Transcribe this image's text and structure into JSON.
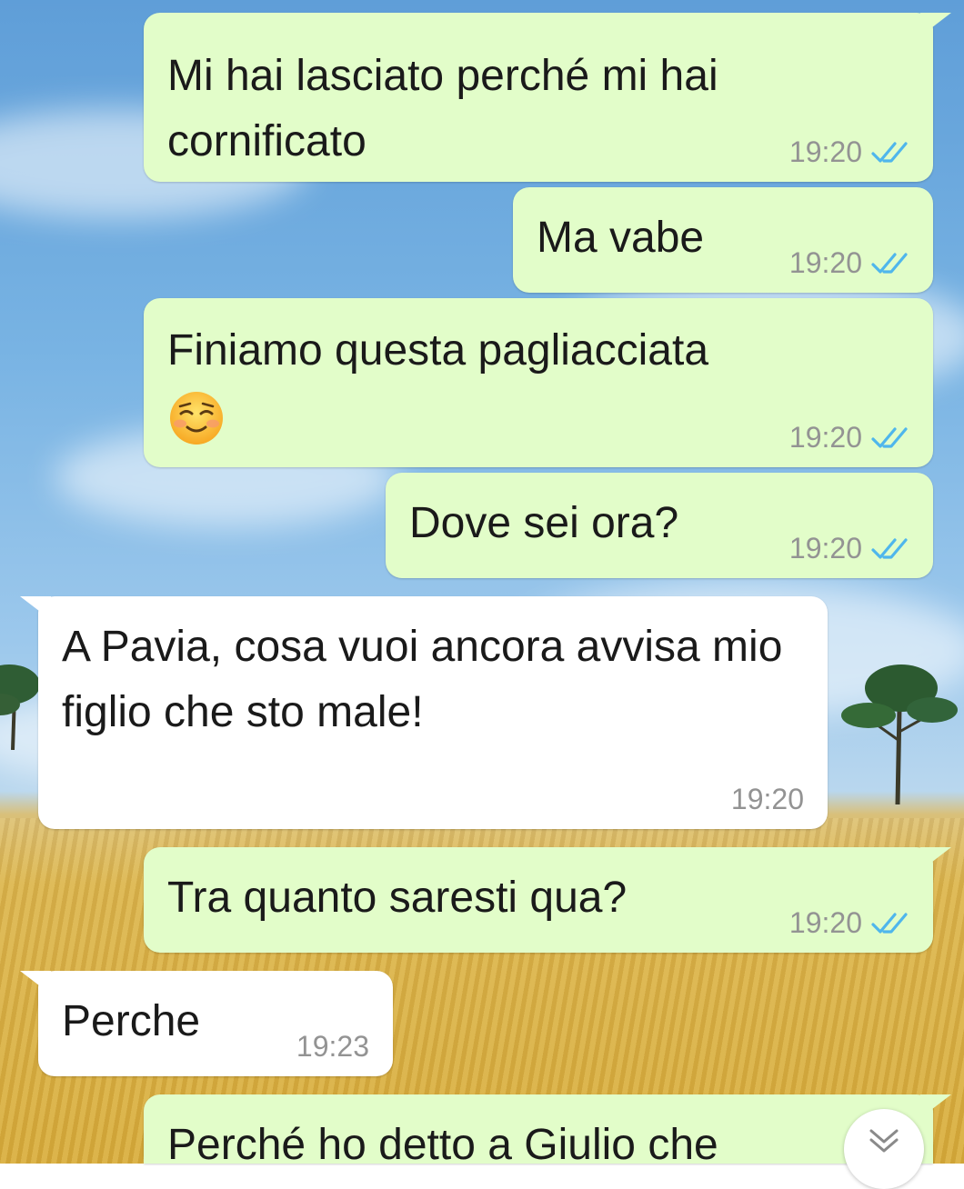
{
  "chat": {
    "messages": [
      {
        "direction": "outgoing",
        "text": "Mi hai lasciato perché mi hai cornificato",
        "time": "19:20",
        "status": "read"
      },
      {
        "direction": "outgoing",
        "text": "Ma vabe",
        "time": "19:20",
        "status": "read"
      },
      {
        "direction": "outgoing",
        "text": "Finiamo questa pagliacciata",
        "emoji": "smiling-face-emoji",
        "time": "19:20",
        "status": "read"
      },
      {
        "direction": "outgoing",
        "text": "Dove sei ora?",
        "time": "19:20",
        "status": "read"
      },
      {
        "direction": "incoming",
        "text": "A Pavia, cosa vuoi ancora avvisa mio figlio che sto male!",
        "time": "19:20"
      },
      {
        "direction": "outgoing",
        "text": "Tra quanto saresti qua?",
        "time": "19:20",
        "status": "read"
      },
      {
        "direction": "incoming",
        "text": "Perche",
        "time": "19:23"
      },
      {
        "direction": "outgoing",
        "text": "Perché ho detto a Giulio che",
        "partially_visible": true
      }
    ],
    "scroll_to_bottom_icon": "double-chevron-down-icon"
  },
  "colors": {
    "outgoing_bubble": "#e2fdc9",
    "incoming_bubble": "#ffffff",
    "read_checks": "#4fb6ec",
    "timestamp": "#939393"
  }
}
